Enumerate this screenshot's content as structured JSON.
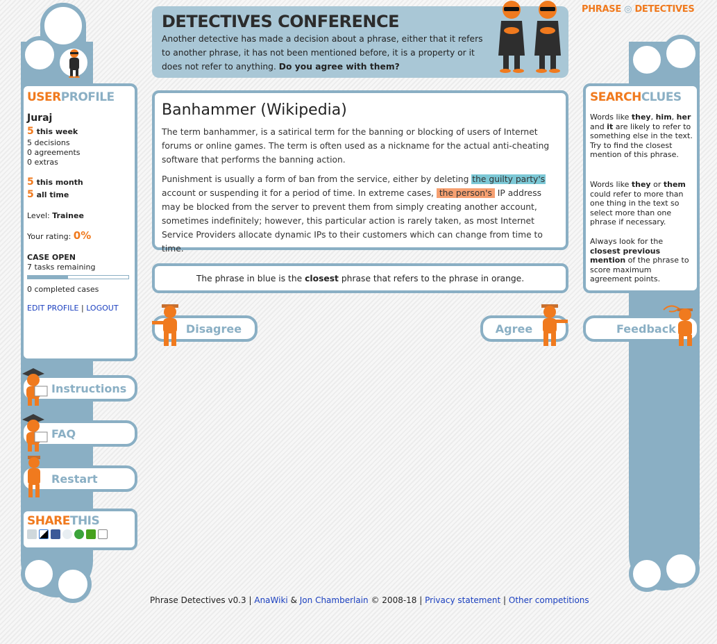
{
  "logo": {
    "part1": "PHRASE",
    "part2": "DETECTIVES"
  },
  "conference": {
    "title": "DETECTIVES CONFERENCE",
    "text": "Another detective has made a decision about a phrase, either that it refers to another phrase, it has not been mentioned before, it is a property or it does not refer to anything.",
    "question": "Do you agree with them?"
  },
  "profile": {
    "heading_a": "USER",
    "heading_b": "PROFILE",
    "name": "Juraj",
    "week_num": "5",
    "week_label": "this week",
    "decisions": "5 decisions",
    "agreements": "0 agreements",
    "extras": "0 extras",
    "month_num": "5",
    "month_label": "this month",
    "all_num": "5",
    "all_label": "all time",
    "level_label": "Level:",
    "level_value": "Trainee",
    "rating_label": "Your rating:",
    "rating_value": "0%",
    "case_open": "CASE OPEN",
    "tasks_remaining": "7 tasks remaining",
    "progress": 0.4,
    "completed": "0 completed cases",
    "edit_profile": "EDIT PROFILE",
    "separator": "|",
    "logout": "LOGOUT"
  },
  "sidebar_buttons": {
    "instructions": "Instructions",
    "faq": "FAQ",
    "restart": "Restart"
  },
  "share": {
    "heading_a": "SHARE",
    "heading_b": "THIS",
    "icons": [
      "digg-icon",
      "delicious-icon",
      "facebook-icon",
      "reddit-icon",
      "stumbleupon-icon",
      "technorati-icon",
      "email-icon"
    ]
  },
  "article": {
    "title": "Banhammer (Wikipedia)",
    "p1": "The term banhammer, is a satirical term for the banning or blocking of users of Internet forums or online games. The term is often used as a nickname for the actual anti-cheating software that performs the banning action.",
    "p2_a": "Punishment is usually a form of ban from the service, either by deleting",
    "p2_blue": "the guilty party's",
    "p2_b": "account or suspending it for a period of time. In extreme cases,",
    "p2_orange": "the person's",
    "p2_c": "IP address may be blocked from the server to prevent them from simply creating another account, sometimes indefinitely; however, this particular action is rarely taken, as most Internet Service Providers allocate dynamic IPs to their customers which can change from time to time."
  },
  "explanation": {
    "a": "The phrase in blue is the",
    "bold": "closest",
    "b": "phrase that refers to the phrase in orange."
  },
  "actions": {
    "disagree": "Disagree",
    "agree": "Agree",
    "feedback": "Feedback"
  },
  "clues": {
    "heading_a": "SEARCH",
    "heading_b": "CLUES",
    "c1_a": "Words like",
    "c1_they": "they",
    "c1_him": "him",
    "c1_her": "her",
    "c1_and": "and",
    "c1_it": "it",
    "c1_b": "are likely to refer to something else in the text. Try to find the closest mention of this phrase.",
    "c2_a": "Words like",
    "c2_they": "they",
    "c2_or": "or",
    "c2_them": "them",
    "c2_b": "could refer to more than one thing in the text so select more than one phrase if necessary.",
    "c3_a": "Always look for the",
    "c3_bold": "closest previous mention",
    "c3_b": "of the phrase to score maximum agreement points."
  },
  "footer": {
    "prefix": "Phrase Detectives v0.3 |",
    "anawiki": "AnaWiki",
    "amp": "&",
    "jon": "Jon Chamberlain",
    "copy": "© 2008-18 |",
    "privacy": "Privacy statement",
    "sep": "|",
    "other": "Other competitions"
  },
  "colors": {
    "accent_orange": "#f07a1e",
    "frame_blue": "#8aafc4",
    "header_blue": "#a9c7d6",
    "highlight_blue": "#7cc8d6",
    "highlight_orange": "#f6a071"
  }
}
